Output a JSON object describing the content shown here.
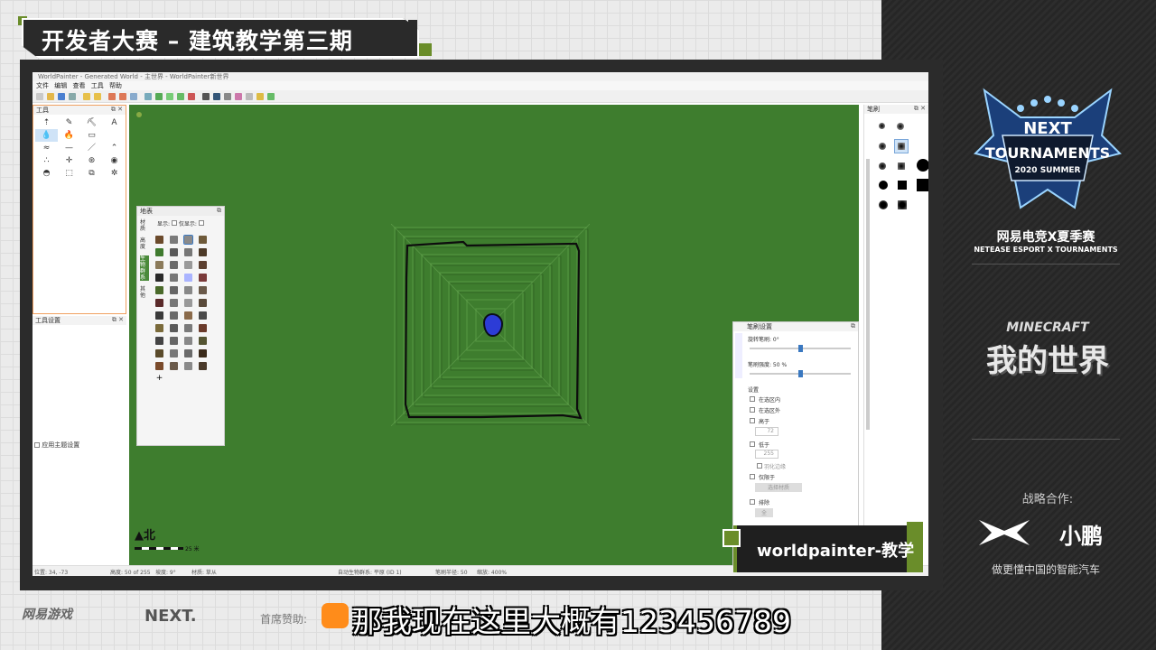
{
  "broadcast": {
    "title": "开发者大赛 – 建筑教学第三期",
    "tag": "worldpainter-教学",
    "subtitle": "那我现在这里大概有123456789",
    "sponsor_label": "首席赞助:",
    "bottom_logos": [
      "网易游戏",
      "NEXT."
    ],
    "accent_color": "#6a8d2a"
  },
  "right_panel": {
    "badge_top": "NEXT",
    "badge_main": "TOURNAMENTS",
    "badge_sub": "2020 SUMMER",
    "event_cn": "网易电竞X夏季赛",
    "event_en": "NETEASE ESPORT X TOURNAMENTS",
    "game_en": "MINECRAFT",
    "game_cn": "我的世界",
    "partner_label": "战略合作:",
    "partner_name": "小鹏",
    "partner_slogan": "做更懂中国的智能汽车"
  },
  "app": {
    "window_title": "WorldPainter - Generated World - 主世界 - WorldPainter新世界",
    "menu": [
      "文件",
      "编辑",
      "查看",
      "工具",
      "帮助"
    ],
    "tools_panel": {
      "title": "工具",
      "icons": [
        "raise-icon",
        "pencil-icon",
        "flood-icon",
        "text-icon",
        "water-icon",
        "lava-icon",
        "height-icon",
        "",
        "smooth-icon",
        "flatten-icon",
        "road-icon",
        "ridge-icon",
        "spray-icon",
        "move-icon",
        "rotate-icon",
        "eye-icon",
        "dome-icon",
        "select-icon",
        "copy-icon",
        "settings-icon"
      ]
    },
    "tool_settings_title": "工具设置",
    "theme_checkbox": "应用主题设置",
    "layers_panel": {
      "title": "地表",
      "show_label": "显示:",
      "solo_label": "仅显示:",
      "tabs": [
        "材质",
        "高度",
        "生物群系",
        "其他"
      ]
    },
    "brush_settings": {
      "title": "笔刷设置",
      "rotation_label": "旋转笔刷: 0°",
      "intensity_label": "笔刷强度: 50 %",
      "section_label": "设置",
      "options": [
        "在选区内",
        "在选区外",
        "高于",
        "低于",
        "仅限于",
        "排除"
      ],
      "above_value": "72",
      "below_value": "255",
      "feather_label": "羽化边缘",
      "pick_button": "选择材质",
      "exclude_button": "全"
    },
    "brushes_title": "笔刷",
    "compass_label": "北",
    "scale_label": "25 米",
    "status": {
      "coords": "位置: 34, -73",
      "height": "高度: 50 of 255",
      "slope": "坡度: 9°",
      "terrain": "材质: 草从",
      "layer": "自动生物群系: 平原 (ID 1)",
      "brush": "笔刷半径: 50",
      "zoom": "缩放: 400%"
    }
  }
}
